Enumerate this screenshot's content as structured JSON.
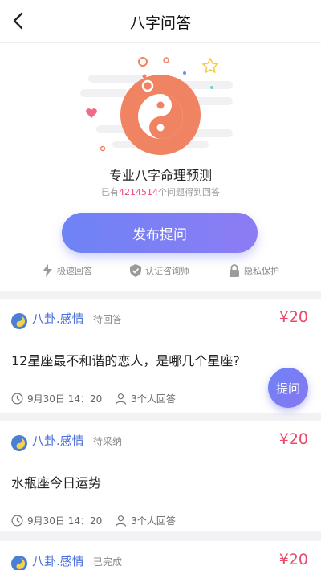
{
  "header": {
    "title": "八字问答"
  },
  "hero": {
    "slogan": "专业八字命理预测",
    "count_prefix": "已有",
    "count_number": "4214514",
    "count_suffix": "个问题得到回答",
    "ask_button": "发布提问",
    "features": [
      "极速回答",
      "认证咨询师",
      "隐私保护"
    ]
  },
  "questions": [
    {
      "category": "八卦.感情",
      "status": "待回答",
      "price": "¥20",
      "question": "12星座最不和谐的恋人，是哪几个星座?",
      "time": "9月30日 14：20",
      "answers": "3个人回答"
    },
    {
      "category": "八卦.感情",
      "status": "待采纳",
      "price": "¥20",
      "question": "水瓶座今日运势",
      "time": "9月30日 14：20",
      "answers": "3个人回答"
    },
    {
      "category": "八卦.感情",
      "status": "已完成",
      "price": "¥20"
    }
  ],
  "fab_label": "提问",
  "colors": {
    "accent": "#6d83f5",
    "price": "#e84a6b",
    "category": "#4a6fd8",
    "count": "#f0437a"
  }
}
